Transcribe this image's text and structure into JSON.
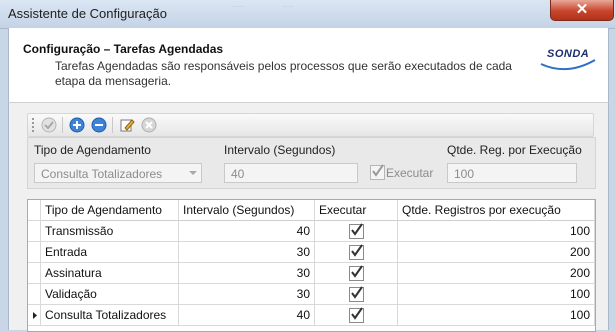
{
  "window": {
    "title": "Assistente de Configuração",
    "close_label": "✕"
  },
  "header": {
    "title": "Configuração – Tarefas Agendadas",
    "description": "Tarefas Agendadas são responsáveis pelos processos que serão executados de cada etapa da mensageria.",
    "logo_text": "SONDA"
  },
  "toolbar": {
    "buttons": [
      "confirm-icon",
      "add-icon",
      "remove-icon",
      "edit-icon",
      "cancel-icon"
    ]
  },
  "form": {
    "tipo_label": "Tipo de Agendamento",
    "tipo_value": "Consulta Totalizadores",
    "intervalo_label": "Intervalo (Segundos)",
    "intervalo_value": "40",
    "executar_label": "Executar",
    "executar_checked": true,
    "qtde_label": "Qtde. Reg. por Execução",
    "qtde_value": "100"
  },
  "grid": {
    "columns": [
      "Tipo de Agendamento",
      "Intervalo (Segundos)",
      "Executar",
      "Qtde. Registros por execução"
    ],
    "rows": [
      {
        "tipo": "Transmissão",
        "intervalo": "40",
        "executar": true,
        "qtde": "100"
      },
      {
        "tipo": "Entrada",
        "intervalo": "30",
        "executar": true,
        "qtde": "200"
      },
      {
        "tipo": "Assinatura",
        "intervalo": "30",
        "executar": true,
        "qtde": "200"
      },
      {
        "tipo": "Validação",
        "intervalo": "30",
        "executar": true,
        "qtde": "100"
      },
      {
        "tipo": "Consulta Totalizadores",
        "intervalo": "40",
        "executar": true,
        "qtde": "100"
      }
    ],
    "current_row": 4
  },
  "colors": {
    "title_bar": "#c3d3e6",
    "close_button": "#c7452c",
    "accent_blue": "#2e6fc7"
  }
}
